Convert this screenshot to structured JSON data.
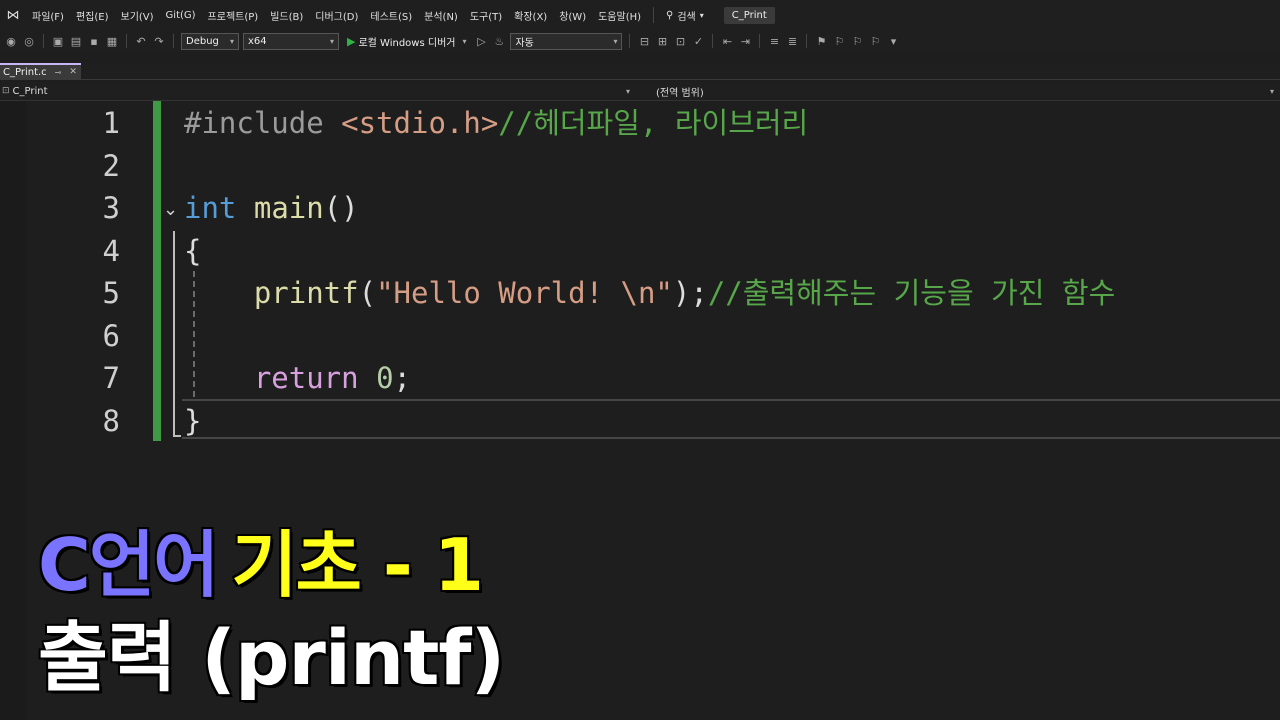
{
  "menubar": {
    "items": [
      "파일(F)",
      "편집(E)",
      "보기(V)",
      "Git(G)",
      "프로젝트(P)",
      "빌드(B)",
      "디버그(D)",
      "테스트(S)",
      "분석(N)",
      "도구(T)",
      "확장(X)",
      "창(W)",
      "도움말(H)"
    ],
    "search_label": "검색",
    "solution_name": "C_Print"
  },
  "toolbar": {
    "configuration": "Debug",
    "platform": "x64",
    "run_label": "로컬 Windows 디버거",
    "auto_label": "자동"
  },
  "tabs": {
    "file_tab_label": "C_Print.c"
  },
  "navbar": {
    "project_scope": "C_Print",
    "global_scope": "(전역 범위)"
  },
  "editor": {
    "line_numbers": [
      "1",
      "2",
      "3",
      "4",
      "5",
      "6",
      "7",
      "8"
    ],
    "lines": {
      "l1_directive": "#include ",
      "l1_header": "<stdio.h>",
      "l1_comment": "//헤더파일, 라이브러리",
      "l3_type": "int",
      "l3_space": " ",
      "l3_name": "main",
      "l3_parens": "()",
      "l4_brace": "{",
      "l5_indent": "    ",
      "l5_func": "printf",
      "l5_open": "(",
      "l5_string": "\"Hello World! \\n\"",
      "l5_close": ");",
      "l5_comment": "//출력해주는 기능을 가진 함수",
      "l7_indent": "    ",
      "l7_keyword": "return",
      "l7_space": " ",
      "l7_value": "0",
      "l7_semicolon": ";",
      "l8_brace": "}"
    }
  },
  "overlay": {
    "title_c": "C언어",
    "title_basic": "기초 - 1",
    "subtitle": "출력 (printf)"
  },
  "colors": {
    "background": "#1e1e1e",
    "change_bar": "#3f9a45",
    "title_c": "#7a73ff",
    "title_basic": "#ffff1a",
    "subtitle": "#ffffff"
  }
}
